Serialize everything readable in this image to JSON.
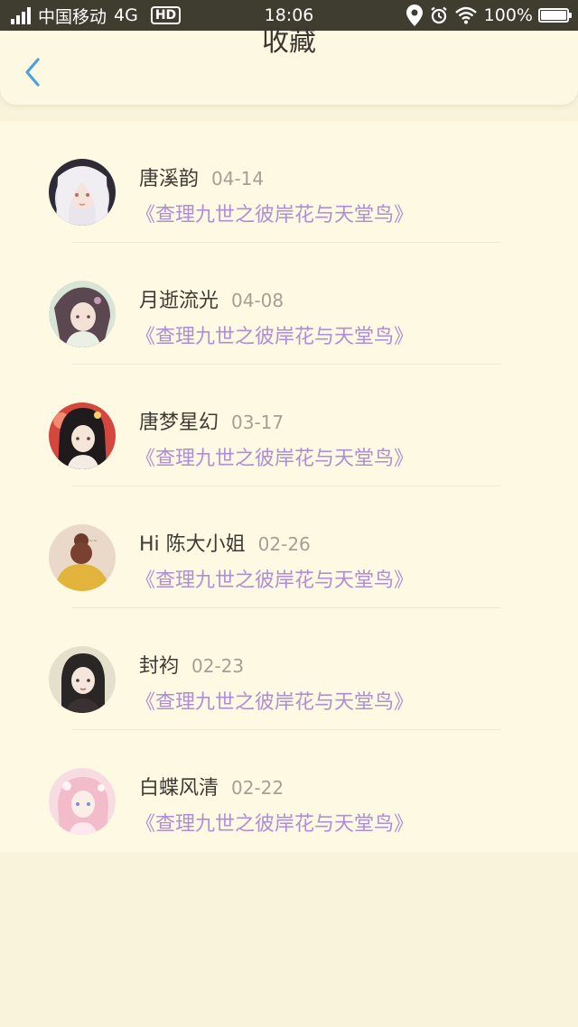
{
  "status_bar": {
    "carrier": "中国移动",
    "network": "4G",
    "hd": "HD",
    "time": "18:06",
    "battery": "100%",
    "battery_level": 1.0,
    "icons": [
      "signal-icon",
      "location-icon",
      "alarm-icon",
      "wifi-icon",
      "battery-icon"
    ]
  },
  "header": {
    "title": "收藏",
    "back_icon": "chevron-left-icon"
  },
  "colors": {
    "background": "#f8f3da",
    "panel": "#fdf9e3",
    "accent": "#4aa3df",
    "book_link": "#b08ed6",
    "date": "#a5a096"
  },
  "favorites": [
    {
      "name": "唐溪韵",
      "date": "04-14",
      "book": "《查理九世之彼岸花与天堂鸟》"
    },
    {
      "name": "月逝流光",
      "date": "04-08",
      "book": "《查理九世之彼岸花与天堂鸟》"
    },
    {
      "name": "唐梦星幻",
      "date": "03-17",
      "book": "《查理九世之彼岸花与天堂鸟》"
    },
    {
      "name": "Hi 陈大小姐",
      "date": "02-26",
      "book": "《查理九世之彼岸花与天堂鸟》"
    },
    {
      "name": "封袀",
      "date": "02-23",
      "book": "《查理九世之彼岸花与天堂鸟》"
    },
    {
      "name": "白蝶风清",
      "date": "02-22",
      "book": "《查理九世之彼岸花与天堂鸟》"
    }
  ]
}
